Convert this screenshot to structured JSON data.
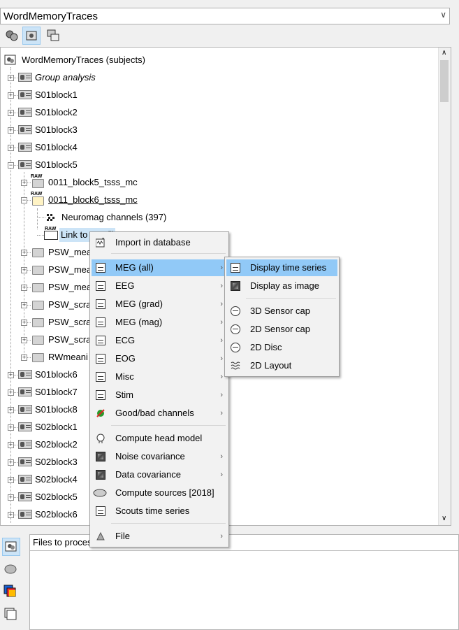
{
  "protocol": {
    "title": "WordMemoryTraces"
  },
  "tree": {
    "root": "WordMemoryTraces (subjects)",
    "items": [
      {
        "label": "Group analysis"
      },
      {
        "label": "S01block1"
      },
      {
        "label": "S01block2"
      },
      {
        "label": "S01block3"
      },
      {
        "label": "S01block4"
      },
      {
        "label": "S01block5"
      },
      {
        "label": "0011_block5_tsss_mc"
      },
      {
        "label": "0011_block6_tsss_mc"
      },
      {
        "label": "Neuromag channels (397)"
      },
      {
        "label": "Link to raw fil"
      },
      {
        "label": "PSW_mea"
      },
      {
        "label": "PSW_mea"
      },
      {
        "label": "PSW_mea"
      },
      {
        "label": "PSW_scra"
      },
      {
        "label": "PSW_scra"
      },
      {
        "label": "PSW_scra"
      },
      {
        "label": "RWmeani"
      },
      {
        "label": "S01block6"
      },
      {
        "label": "S01block7"
      },
      {
        "label": "S01block8"
      },
      {
        "label": "S02block1"
      },
      {
        "label": "S02block2"
      },
      {
        "label": "S02block3"
      },
      {
        "label": "S02block4"
      },
      {
        "label": "S02block5"
      },
      {
        "label": "S02block6"
      }
    ]
  },
  "files_panel": {
    "label": "Files to proces"
  },
  "context_menu": {
    "items": [
      {
        "label": "Import in database"
      },
      {
        "label": "MEG (all)"
      },
      {
        "label": "EEG"
      },
      {
        "label": "MEG (grad)"
      },
      {
        "label": "MEG (mag)"
      },
      {
        "label": "ECG"
      },
      {
        "label": "EOG"
      },
      {
        "label": "Misc"
      },
      {
        "label": "Stim"
      },
      {
        "label": "Good/bad channels"
      },
      {
        "label": "Compute head model"
      },
      {
        "label": "Noise covariance"
      },
      {
        "label": "Data covariance"
      },
      {
        "label": "Compute sources [2018]"
      },
      {
        "label": "Scouts time series"
      },
      {
        "label": "File"
      }
    ]
  },
  "submenu": {
    "items": [
      {
        "label": "Display time series"
      },
      {
        "label": "Display as image"
      },
      {
        "label": "3D Sensor cap"
      },
      {
        "label": "2D Sensor cap"
      },
      {
        "label": "2D Disc"
      },
      {
        "label": "2D Layout"
      }
    ]
  },
  "icons": [
    "subject-icon",
    "folder-icon",
    "raw-file-icon",
    "channel-icon",
    "time-series-icon",
    "image-icon",
    "sensor-cap-icon",
    "layout-icon",
    "head-icon",
    "sources-icon",
    "file-icon"
  ],
  "colors": {
    "highlight": "#91c9f7",
    "selection": "#cce4f7"
  }
}
